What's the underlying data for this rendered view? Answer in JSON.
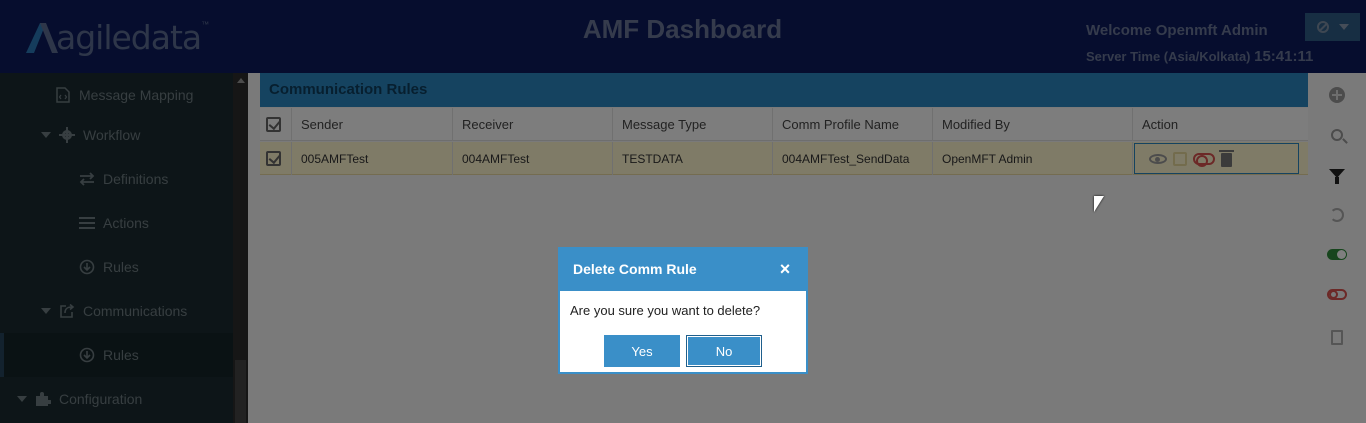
{
  "header": {
    "logo_text": "agiledata",
    "logo_tm": "™",
    "dashboard_title": "AMF Dashboard",
    "welcome": "Welcome Openmft Admin",
    "server_time_label": "Server Time (Asia/Kolkata)",
    "server_time_value": "15:41:11",
    "user_menu_icon": "ban-icon"
  },
  "sidebar": {
    "items": [
      {
        "label": "Message Mapping",
        "icon": "file-code-icon"
      },
      {
        "label": "Workflow",
        "icon": "gear-icon"
      },
      {
        "label": "Definitions",
        "icon": "exchange-icon"
      },
      {
        "label": "Actions",
        "icon": "bars-icon"
      },
      {
        "label": "Rules",
        "icon": "circle-arrow-icon"
      },
      {
        "label": "Communications",
        "icon": "share-icon"
      },
      {
        "label": "Rules",
        "icon": "circle-arrow-icon"
      },
      {
        "label": "Configuration",
        "icon": "puzzle-icon"
      }
    ]
  },
  "panel": {
    "title": "Communication Rules",
    "columns": [
      "Sender",
      "Receiver",
      "Message Type",
      "Comm Profile Name",
      "Modified By",
      "Action"
    ],
    "rows": [
      {
        "sender": "005AMFTest",
        "receiver": "004AMFTest",
        "message_type": "TESTDATA",
        "comm_profile_name": "004AMFTest_SendData",
        "modified_by": "OpenMFT Admin"
      }
    ]
  },
  "toolbar": {
    "icons": [
      "plus-circle-icon",
      "search-icon",
      "filter-icon",
      "refresh-icon",
      "toggle-on-icon",
      "toggle-off-icon",
      "file-excel-icon"
    ]
  },
  "modal": {
    "title": "Delete Comm Rule",
    "close": "×",
    "message": "Are you sure you want to delete?",
    "yes_label": "Yes",
    "no_label": "No"
  },
  "colors": {
    "header_bg": "#0c1b5c",
    "sidebar_bg": "#1a2b30",
    "accent": "#2b87c1",
    "selected_row": "#fff6cf"
  }
}
